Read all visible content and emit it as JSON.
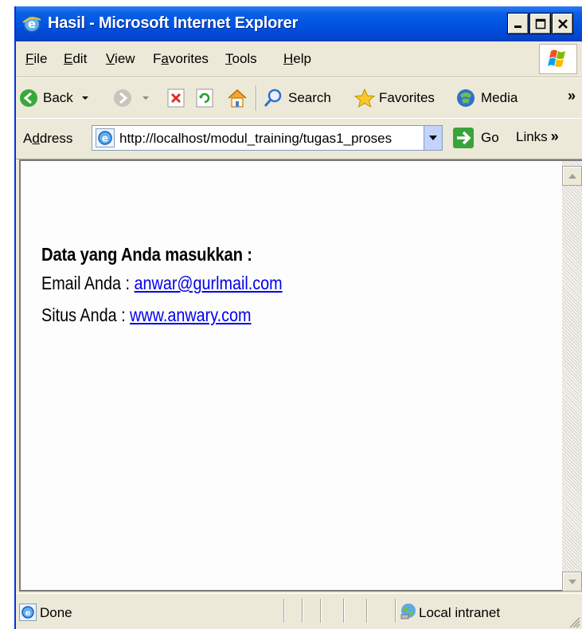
{
  "window": {
    "title": "Hasil - Microsoft Internet Explorer"
  },
  "menu": [
    {
      "accel": "F",
      "rest": "ile"
    },
    {
      "accel": "E",
      "rest": "dit"
    },
    {
      "accel": "V",
      "rest": "iew"
    },
    {
      "pre": "F",
      "accel": "a",
      "rest": "vorites"
    },
    {
      "accel": "T",
      "rest": "ools"
    },
    {
      "accel": "H",
      "rest": "elp"
    }
  ],
  "toolbar": {
    "back_label": "Back",
    "search_label": "Search",
    "favorites_label": "Favorites",
    "media_label": "Media",
    "more": "»"
  },
  "address": {
    "label_pre": "A",
    "label_accel": "d",
    "label_rest": "dress",
    "url": "http://localhost/modul_training/tugas1_proses",
    "go_label": "Go",
    "links_label": "Links",
    "links_more": "»"
  },
  "content": {
    "heading": "Data yang Anda masukkan :",
    "email_label": "Email Anda : ",
    "email_value": "anwar@gurlmail.com",
    "site_label": "Situs Anda : ",
    "site_value": "www.anwary.com"
  },
  "status": {
    "text": "Done",
    "zone": "Local intranet"
  },
  "colors": {
    "titlebar": "#0054e3",
    "chrome": "#ece9d8",
    "link": "#0000ee"
  }
}
